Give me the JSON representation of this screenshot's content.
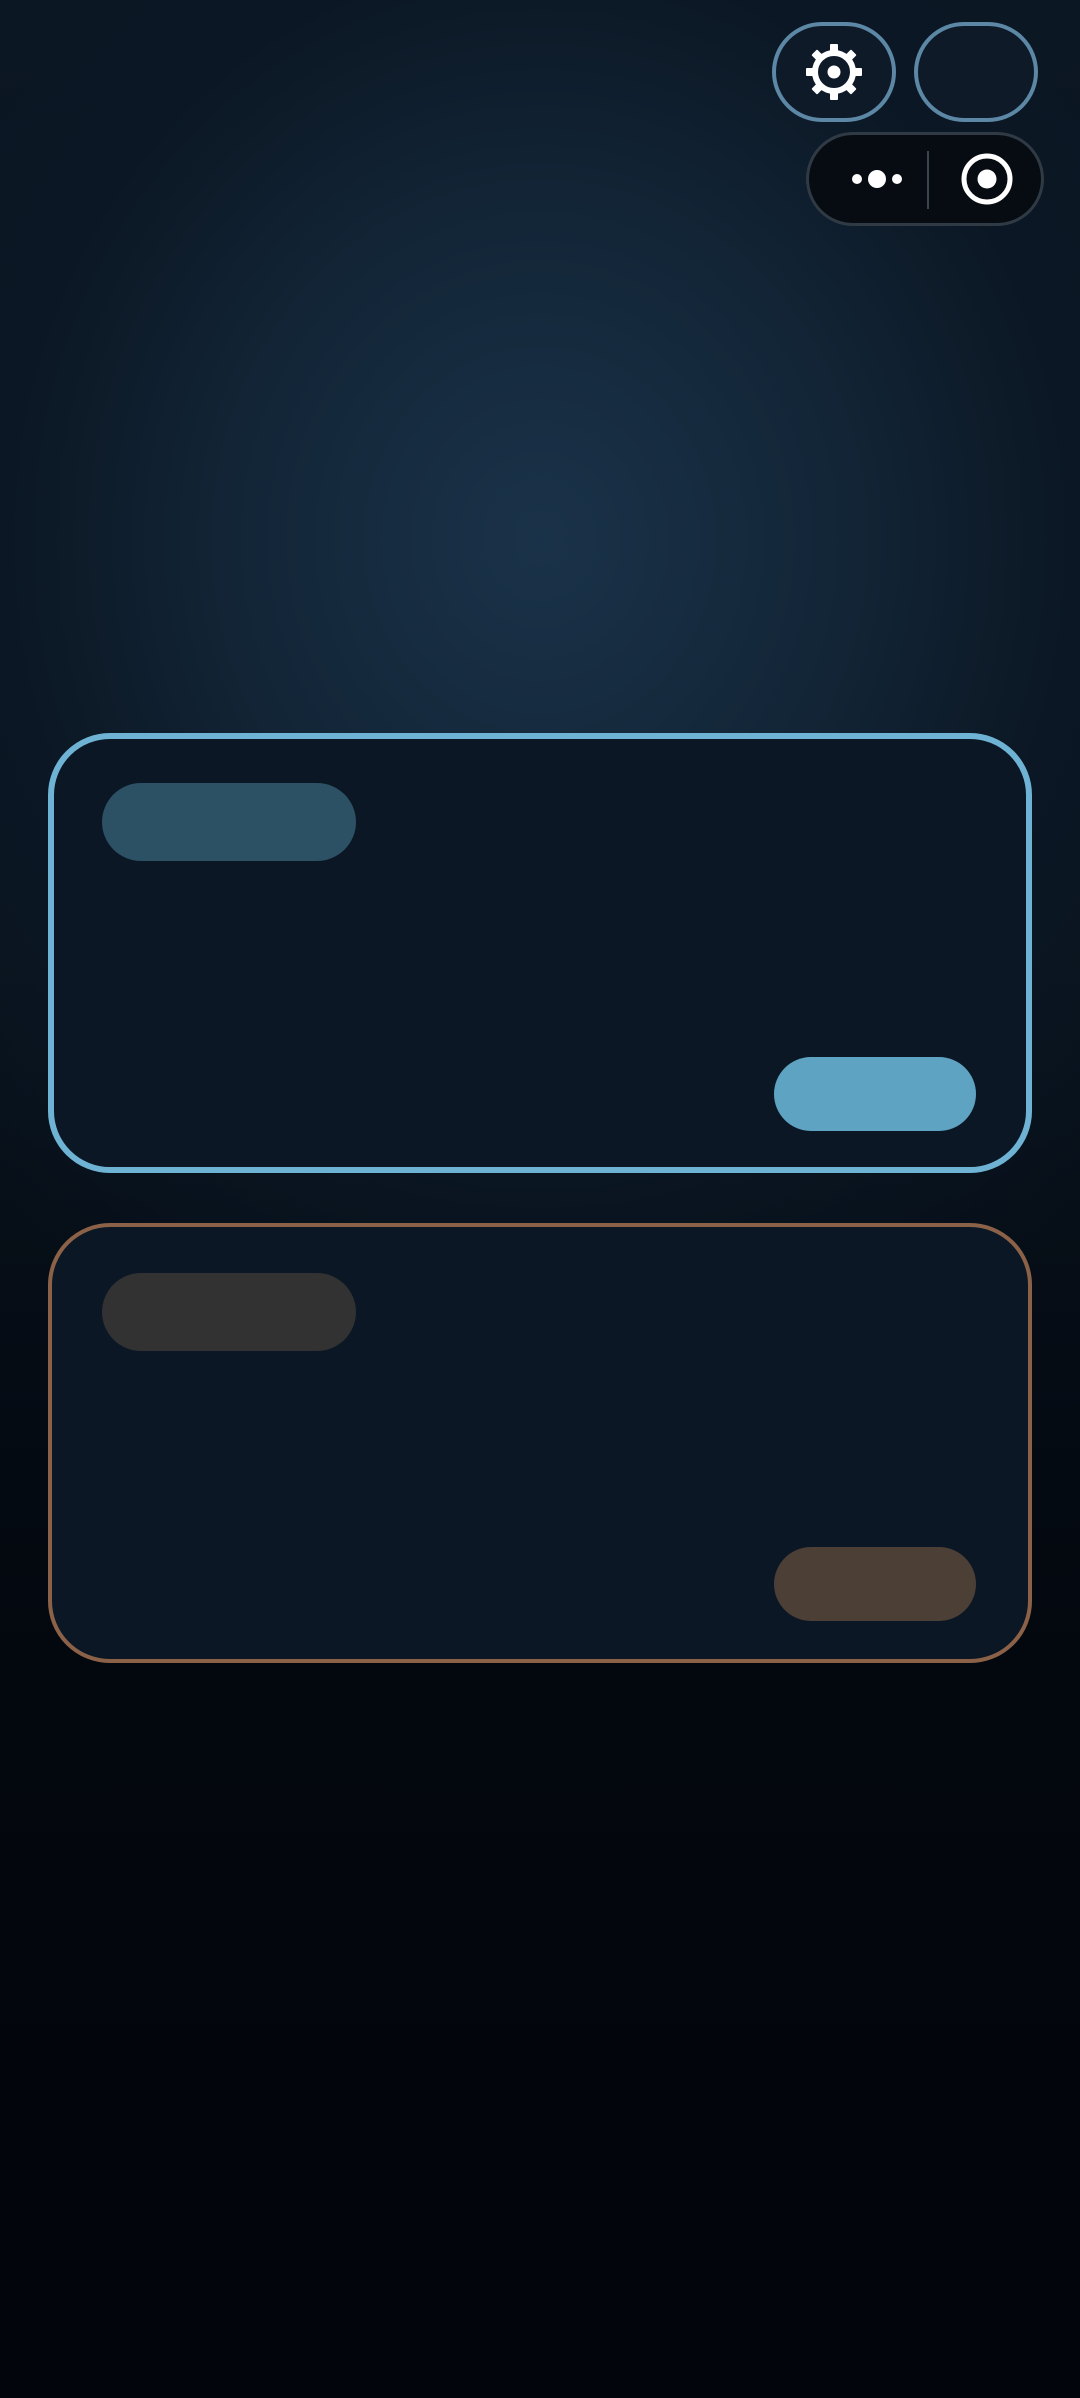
{
  "header": {
    "settings_icon": "gear-icon",
    "more_icon": "more-dots-icon",
    "target_icon": "target-icon"
  },
  "cards": [
    {
      "tag_label": "",
      "action_label": "",
      "border_color": "#6eb3d4",
      "tag_color": "#2c5064",
      "action_color": "#5fa3c3"
    },
    {
      "tag_label": "",
      "action_label": "",
      "border_color": "#8b6147",
      "tag_color": "#323232",
      "action_color": "#4b3f36"
    }
  ]
}
